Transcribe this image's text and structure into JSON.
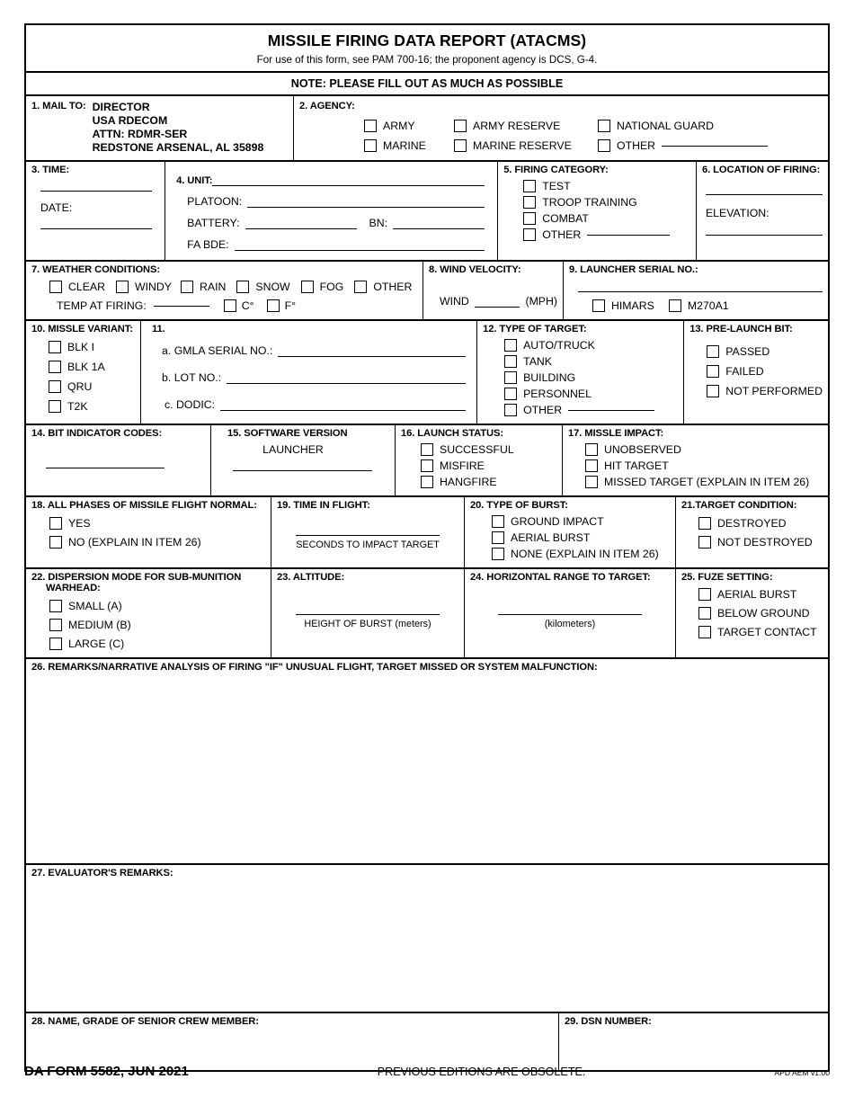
{
  "form": {
    "title": "MISSILE FIRING DATA REPORT (ATACMS)",
    "subtitle": "For use of this form, see PAM 700-16; the proponent agency is DCS, G-4.",
    "note": "NOTE: PLEASE FILL OUT AS MUCH AS POSSIBLE",
    "footer_form_id": "DA FORM 5582, JUN 2021",
    "footer_center": "PREVIOUS EDITIONS ARE OBSOLETE.",
    "footer_right": "APD AEM v1.00"
  },
  "item1": {
    "label": "1. MAIL TO:",
    "address": [
      "DIRECTOR",
      "USA RDECOM",
      "ATTN: RDMR-SER",
      "REDSTONE ARSENAL, AL 35898"
    ]
  },
  "item2": {
    "label": "2. AGENCY:",
    "options_row1": [
      "ARMY",
      "ARMY RESERVE",
      "NATIONAL GUARD"
    ],
    "options_row2": [
      "MARINE",
      "MARINE RESERVE",
      "OTHER"
    ]
  },
  "item3": {
    "label": "3. TIME:",
    "date_label": "DATE:"
  },
  "item4": {
    "label": "4. UNIT:",
    "platoon_label": "PLATOON:",
    "battery_label": "BATTERY:",
    "bn_label": "BN:",
    "fabde_label": "FA BDE:"
  },
  "item5": {
    "label": "5. FIRING CATEGORY:",
    "options": [
      "TEST",
      "TROOP TRAINING",
      "COMBAT",
      "OTHER"
    ]
  },
  "item6": {
    "label": "6. LOCATION OF FIRING:",
    "elevation_label": "ELEVATION:"
  },
  "item7": {
    "label": "7. WEATHER CONDITIONS:",
    "options": [
      "CLEAR",
      "WINDY",
      "RAIN",
      "SNOW",
      "FOG",
      "OTHER"
    ],
    "temp_label": "TEMP AT FIRING:",
    "unit_c": "C°",
    "unit_f": "F°"
  },
  "item8": {
    "label": "8. WIND VELOCITY:",
    "wind_label": "WIND",
    "mph_label": "(MPH)"
  },
  "item9": {
    "label": "9. LAUNCHER SERIAL NO.:",
    "options": [
      "HIMARS",
      "M270A1"
    ]
  },
  "item10": {
    "label": "10. MISSLE VARIANT:",
    "options": [
      "BLK I",
      "BLK 1A",
      "QRU",
      "T2K"
    ]
  },
  "item11": {
    "label": "11.",
    "a_label": "a. GMLA SERIAL NO.:",
    "b_label": "b. LOT NO.:",
    "c_label": "c. DODIC:"
  },
  "item12": {
    "label": "12. TYPE OF TARGET:",
    "options": [
      "AUTO/TRUCK",
      "TANK",
      "BUILDING",
      "PERSONNEL",
      "OTHER"
    ]
  },
  "item13": {
    "label": "13. PRE-LAUNCH BIT:",
    "options": [
      "PASSED",
      "FAILED",
      "NOT PERFORMED"
    ]
  },
  "item14": {
    "label": "14. BIT INDICATOR CODES:"
  },
  "item15": {
    "label": "15. SOFTWARE VERSION",
    "sub_label": "LAUNCHER"
  },
  "item16": {
    "label": "16. LAUNCH STATUS:",
    "options": [
      "SUCCESSFUL",
      "MISFIRE",
      "HANGFIRE"
    ]
  },
  "item17": {
    "label": "17. MISSLE IMPACT:",
    "options": [
      "UNOBSERVED",
      "HIT TARGET",
      "MISSED TARGET (EXPLAIN IN ITEM 26)"
    ]
  },
  "item18": {
    "label": "18. ALL PHASES OF MISSILE FLIGHT NORMAL:",
    "options": [
      "YES",
      "NO (EXPLAIN IN ITEM 26)"
    ]
  },
  "item19": {
    "label": "19. TIME IN FLIGHT:",
    "caption": "SECONDS TO IMPACT TARGET"
  },
  "item20": {
    "label": "20. TYPE OF BURST:",
    "options": [
      "GROUND IMPACT",
      "AERIAL BURST",
      "NONE (EXPLAIN IN ITEM 26)"
    ]
  },
  "item21": {
    "label": "21.TARGET CONDITION:",
    "options": [
      "DESTROYED",
      "NOT DESTROYED"
    ]
  },
  "item22": {
    "label_line1": "22. DISPERSION MODE FOR SUB-MUNITION",
    "label_line2": "WARHEAD:",
    "options": [
      "SMALL (A)",
      "MEDIUM (B)",
      "LARGE (C)"
    ]
  },
  "item23": {
    "label": "23. ALTITUDE:",
    "caption": "HEIGHT OF BURST (meters)"
  },
  "item24": {
    "label": "24. HORIZONTAL RANGE TO TARGET:",
    "caption": "(kilometers)"
  },
  "item25": {
    "label": "25. FUZE SETTING:",
    "options": [
      "AERIAL BURST",
      "BELOW GROUND",
      "TARGET CONTACT"
    ]
  },
  "item26": {
    "label": "26. REMARKS/NARRATIVE ANALYSIS OF FIRING \"IF\" UNUSUAL FLIGHT, TARGET MISSED OR SYSTEM MALFUNCTION:"
  },
  "item27": {
    "label": "27. EVALUATOR'S REMARKS:"
  },
  "item28": {
    "label": "28. NAME, GRADE OF SENIOR CREW MEMBER:"
  },
  "item29": {
    "label": "29. DSN NUMBER:"
  }
}
